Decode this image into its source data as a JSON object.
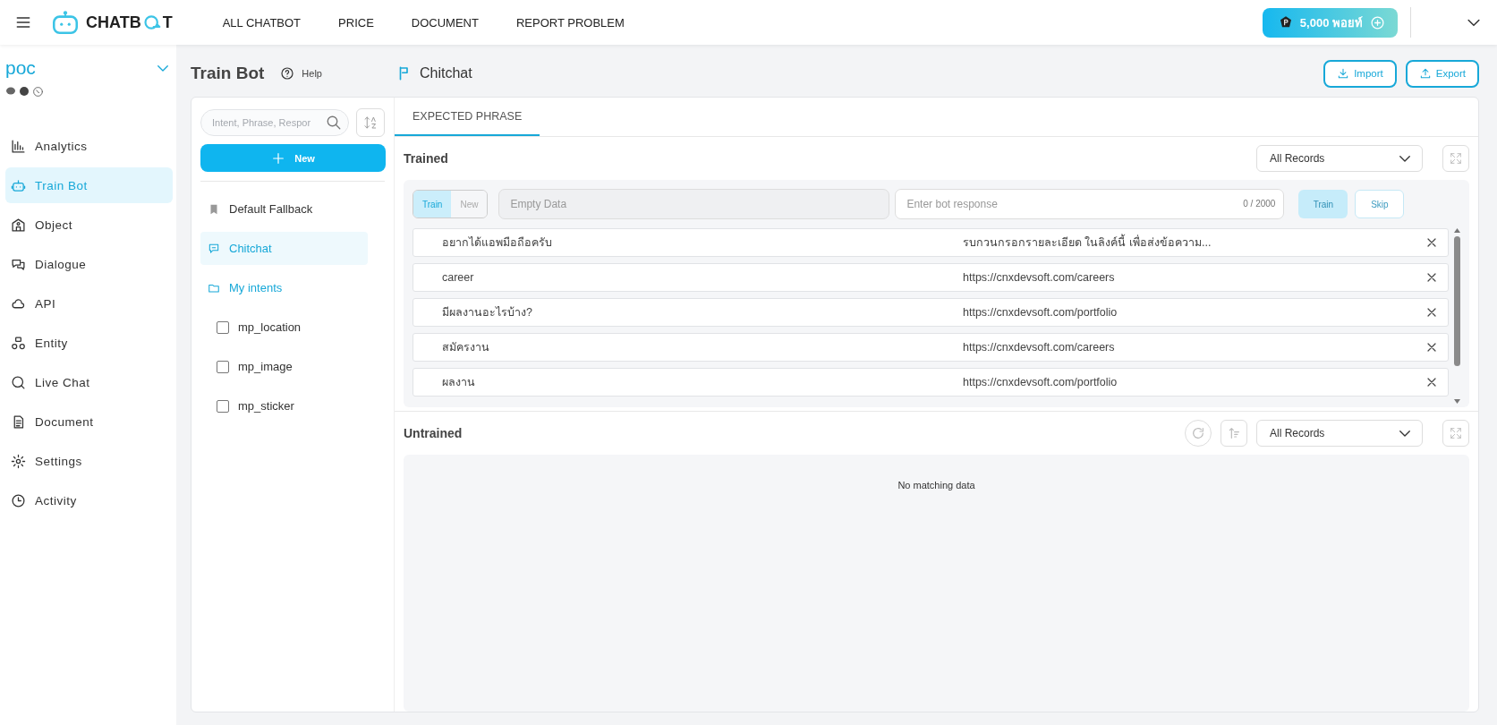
{
  "topbar": {
    "brand_left": "CHATB",
    "brand_right": "T",
    "nav": [
      "ALL CHATBOT",
      "PRICE",
      "DOCUMENT",
      "REPORT PROBLEM"
    ],
    "points": "5,000 พอยท์"
  },
  "sidebar": {
    "bot_name": "poc",
    "items": [
      {
        "label": "Analytics",
        "selected": false
      },
      {
        "label": "Train Bot",
        "selected": true
      },
      {
        "label": "Object",
        "selected": false
      },
      {
        "label": "Dialogue",
        "selected": false
      },
      {
        "label": "API",
        "selected": false
      },
      {
        "label": "Entity",
        "selected": false
      },
      {
        "label": "Live Chat",
        "selected": false
      },
      {
        "label": "Document",
        "selected": false
      },
      {
        "label": "Settings",
        "selected": false
      },
      {
        "label": "Activity",
        "selected": false
      }
    ]
  },
  "train_bot": {
    "title": "Train Bot",
    "help": "Help",
    "search": {
      "placeholder": "Intent, Phrase, Respor"
    },
    "new_button": "New",
    "intents": [
      {
        "kind": "fallback",
        "label": "Default Fallback",
        "selected": false
      },
      {
        "kind": "chitchat",
        "label": "Chitchat",
        "selected": true
      },
      {
        "kind": "folder",
        "label": "My intents",
        "children": [
          {
            "label": "mp_location",
            "checked": false
          },
          {
            "label": "mp_image",
            "checked": false
          },
          {
            "label": "mp_sticker",
            "checked": false
          }
        ]
      }
    ]
  },
  "content": {
    "title": "Chitchat",
    "import": "Import",
    "export": "Export",
    "tabs": [
      {
        "label": "EXPECTED PHRASE",
        "selected": true
      }
    ],
    "trained": {
      "title": "Trained",
      "filter": "All Records",
      "mode": [
        {
          "label": "Train",
          "selected": true
        },
        {
          "label": "New",
          "selected": false
        }
      ],
      "phrase": {
        "placeholder": "Empty Data"
      },
      "response": {
        "placeholder": "Enter bot response"
      },
      "counter": "0 / 2000",
      "train_button": {
        "label": "Train",
        "disabled": true
      },
      "skip_button": {
        "label": "Skip",
        "disabled": true
      },
      "rows": [
        {
          "phrase": "อยากได้แอพมือถือครับ",
          "response": "รบกวนกรอกรายละเอียด ในลิงค์นี้ เพื่อส่งข้อความ..."
        },
        {
          "phrase": "career",
          "response": "https://cnxdevsoft.com/careers"
        },
        {
          "phrase": "มีผลงานอะไรบ้าง?",
          "response": "https://cnxdevsoft.com/portfolio"
        },
        {
          "phrase": "สมัครงาน",
          "response": "https://cnxdevsoft.com/careers"
        },
        {
          "phrase": "ผลงาน",
          "response": "https://cnxdevsoft.com/portfolio"
        }
      ]
    },
    "untrained": {
      "title": "Untrained",
      "filter": "All Records",
      "empty": "No matching data"
    }
  }
}
